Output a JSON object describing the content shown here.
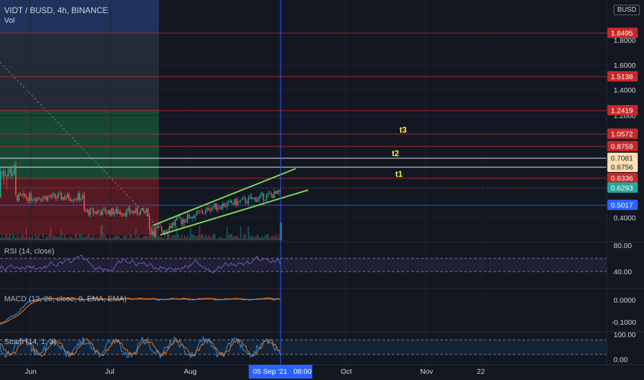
{
  "header": {
    "symbol": "VIDT / BUSD, 4h, BINANCE",
    "volume_label": "Vol",
    "currency": "BUSD"
  },
  "colors": {
    "background": "#131722",
    "up_candle": "#26a69a",
    "down_candle": "#ef5350",
    "channel": "#7ed957",
    "level_red": "#c62828",
    "level_blue": "#2962ff",
    "level_white": "#ffffff",
    "fib_blue": "#2a4b8d",
    "fib_green": "#1b5e3a",
    "fib_red": "#6b1c24",
    "rsi": "#7e57c2",
    "macd": "#2196f3",
    "signal": "#ff6d00",
    "crosshair": "#2962ff"
  },
  "price_axis": {
    "ticks": [
      "1.8000",
      "1.6000",
      "1.4000",
      "1.2000",
      "0.4000"
    ],
    "badges": [
      {
        "label": "1.8495",
        "value": 1.8495,
        "bg": "#c62828",
        "fg": "#ffffff"
      },
      {
        "label": "1.5138",
        "value": 1.5138,
        "bg": "#c62828",
        "fg": "#ffffff"
      },
      {
        "label": "1.2419",
        "value": 1.2419,
        "bg": "#c62828",
        "fg": "#ffffff"
      },
      {
        "label": "1.0572",
        "value": 1.0572,
        "bg": "#c62828",
        "fg": "#ffffff"
      },
      {
        "label": "0.8759",
        "value": 0.8759,
        "bg": "#c62828",
        "fg": "#ffffff"
      },
      {
        "label": "0.7081",
        "value": 0.7081,
        "bg": "#ffe0b2",
        "fg": "#131722"
      },
      {
        "label": "0.6756",
        "value": 0.6756,
        "bg": "#ffe0b2",
        "fg": "#131722"
      },
      {
        "label": "0.6336",
        "value": 0.6336,
        "bg": "#c62828",
        "fg": "#ffffff"
      },
      {
        "label": "0.6293",
        "value": 0.6293,
        "bg": "#26a69a",
        "fg": "#ffffff"
      },
      {
        "label": "0.5017",
        "value": 0.5017,
        "bg": "#2962ff",
        "fg": "#ffffff"
      }
    ]
  },
  "targets": [
    {
      "label": "t3"
    },
    {
      "label": "t2"
    },
    {
      "label": "t1"
    }
  ],
  "indicators": {
    "rsi": {
      "label": "RSI (14, close)",
      "ticks": [
        "80.00",
        "40.00"
      ]
    },
    "macd": {
      "label": "MACD (12, 26, close, 9, EMA, EMA)",
      "ticks": [
        "0.0000",
        "-0.1000"
      ]
    },
    "stoch": {
      "label": "Stoch (14, 1, 3)",
      "ticks": [
        "100.00",
        "0.00"
      ]
    }
  },
  "time_axis": {
    "labels": [
      "Jun",
      "Jul",
      "Aug",
      "Oct",
      "Nov",
      "22"
    ],
    "crosshair_label": "05 Sep '21   08:00"
  }
}
